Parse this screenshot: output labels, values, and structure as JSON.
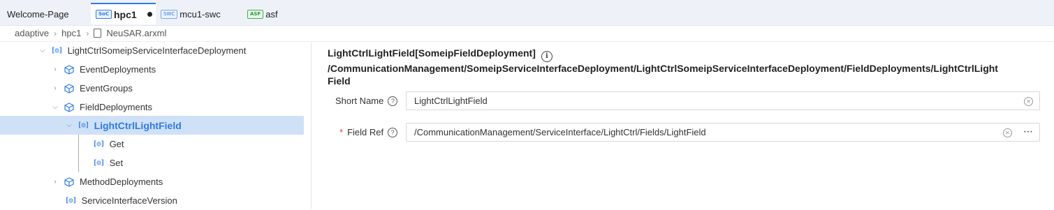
{
  "tabs": [
    {
      "label": "Welcome-Page"
    },
    {
      "label": "hpc1",
      "badge": "SoC",
      "modified": true
    },
    {
      "label": "mcu1-swc",
      "badge": "SWC"
    },
    {
      "label": "asf",
      "badge": "ASF"
    }
  ],
  "breadcrumb": {
    "items": [
      "adaptive",
      "hpc1",
      "NeuSAR.arxml"
    ]
  },
  "tree": {
    "items": [
      {
        "label": "LightCtrlSomeipServiceInterfaceDeployment",
        "icon": "service-icon",
        "expanded": true
      },
      {
        "label": "EventDeployments",
        "icon": "box-icon"
      },
      {
        "label": "EventGroups",
        "icon": "box-icon"
      },
      {
        "label": "FieldDeployments",
        "icon": "box-icon",
        "expanded": true
      },
      {
        "label": "LightCtrlLightField",
        "icon": "service-icon",
        "selected": true
      },
      {
        "label": "Get",
        "icon": "service-icon"
      },
      {
        "label": "Set",
        "icon": "service-icon"
      },
      {
        "label": "MethodDeployments",
        "icon": "box-icon"
      },
      {
        "label": "ServiceInterfaceVersion",
        "icon": "service-icon"
      }
    ]
  },
  "detail": {
    "title": "LightCtrlLightField[SomeipFieldDeployment]",
    "path_line1": "/CommunicationManagement/SomeipServiceInterfaceDeployment/LightCtrlSomeipServiceInterfaceDeployment/FieldDeployments/LightCtrlLight",
    "path_line2": "Field",
    "short_name_label": "Short Name",
    "short_name_value": "LightCtrlLightField",
    "field_ref_label": "Field Ref",
    "field_ref_value": "/CommunicationManagement/ServiceInterface/LightCtrl/Fields/LightField"
  },
  "colors": {
    "accent": "#2f7ae5",
    "selected_bg": "#cfe1f7",
    "required": "#e23c3c"
  }
}
